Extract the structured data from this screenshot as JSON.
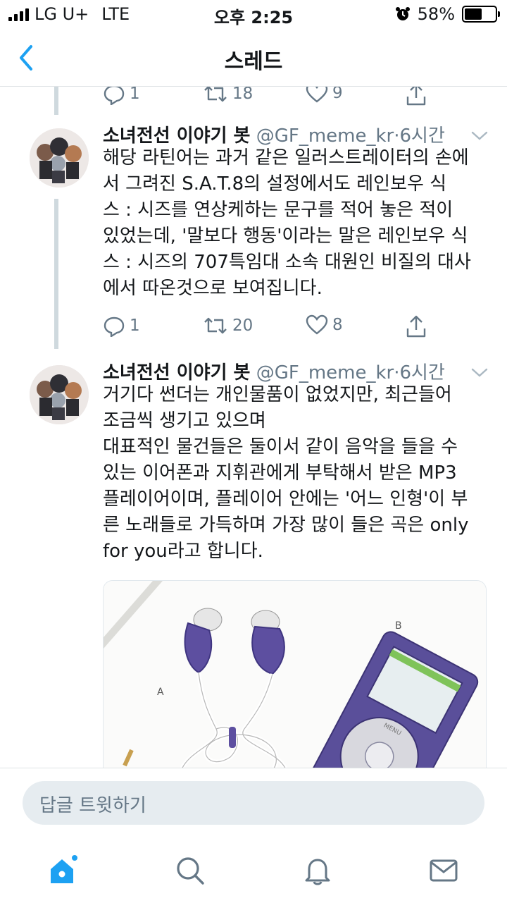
{
  "status_bar": {
    "carrier": "LG U+",
    "network": "LTE",
    "time": "오후 2:25",
    "battery": "58%",
    "battery_level": 0.58
  },
  "nav": {
    "title": "스레드",
    "back_icon": "chevron-left-icon"
  },
  "previous_tweet_actions": {
    "replies": "1",
    "retweets": "18",
    "likes": "9"
  },
  "tweets": [
    {
      "name": "소녀전선 이야기 봇",
      "handle": "@GF_meme_kr",
      "separator": "·",
      "time": "6시간",
      "lines": [
        "해당 라틴어는 과거 같은 일러스트레이터의 손에",
        "서 그려진 S.A.T.8의 설정에서도 레인보우 식",
        "스 : 시즈를 연상케하는 문구를 적어 놓은 적이",
        "있었는데, '말보다 행동'이라는 말은 레인보우 식",
        "스 : 시즈의 707특임대 소속 대원인 비질의 대사",
        "에서 따온것으로 보여집니다."
      ],
      "replies": "1",
      "retweets": "20",
      "likes": "8"
    },
    {
      "name": "소녀전선 이야기 봇",
      "handle": "@GF_meme_kr",
      "separator": "·",
      "time": "6시간",
      "lines": [
        "거기다 썬더는 개인물품이 없었지만, 최근들어",
        "조금씩 생기고 있으며",
        "대표적인 물건들은 둘이서 같이 음악을 들을 수",
        "있는 이어폰과 지휘관에게 부탁해서 받은 MP3",
        "플레이어이며, 플레이어 안에는 '어느 인형'이 부",
        "른 노래들로 가득하며 가장 많이 들은 곡은 only",
        "for you라고 합니다."
      ],
      "media": {
        "label_a": "A",
        "label_b": "B",
        "player_menu": "MENU"
      }
    }
  ],
  "reply_bar": {
    "placeholder": "답글 트윗하기"
  },
  "tabs": [
    "home-icon",
    "search-icon",
    "notifications-bell-icon",
    "messages-envelope-icon"
  ],
  "colors": {
    "accent": "#1da1f2",
    "text": "#14171a",
    "secondary": "#657786",
    "thread_line": "#cfd9de"
  }
}
